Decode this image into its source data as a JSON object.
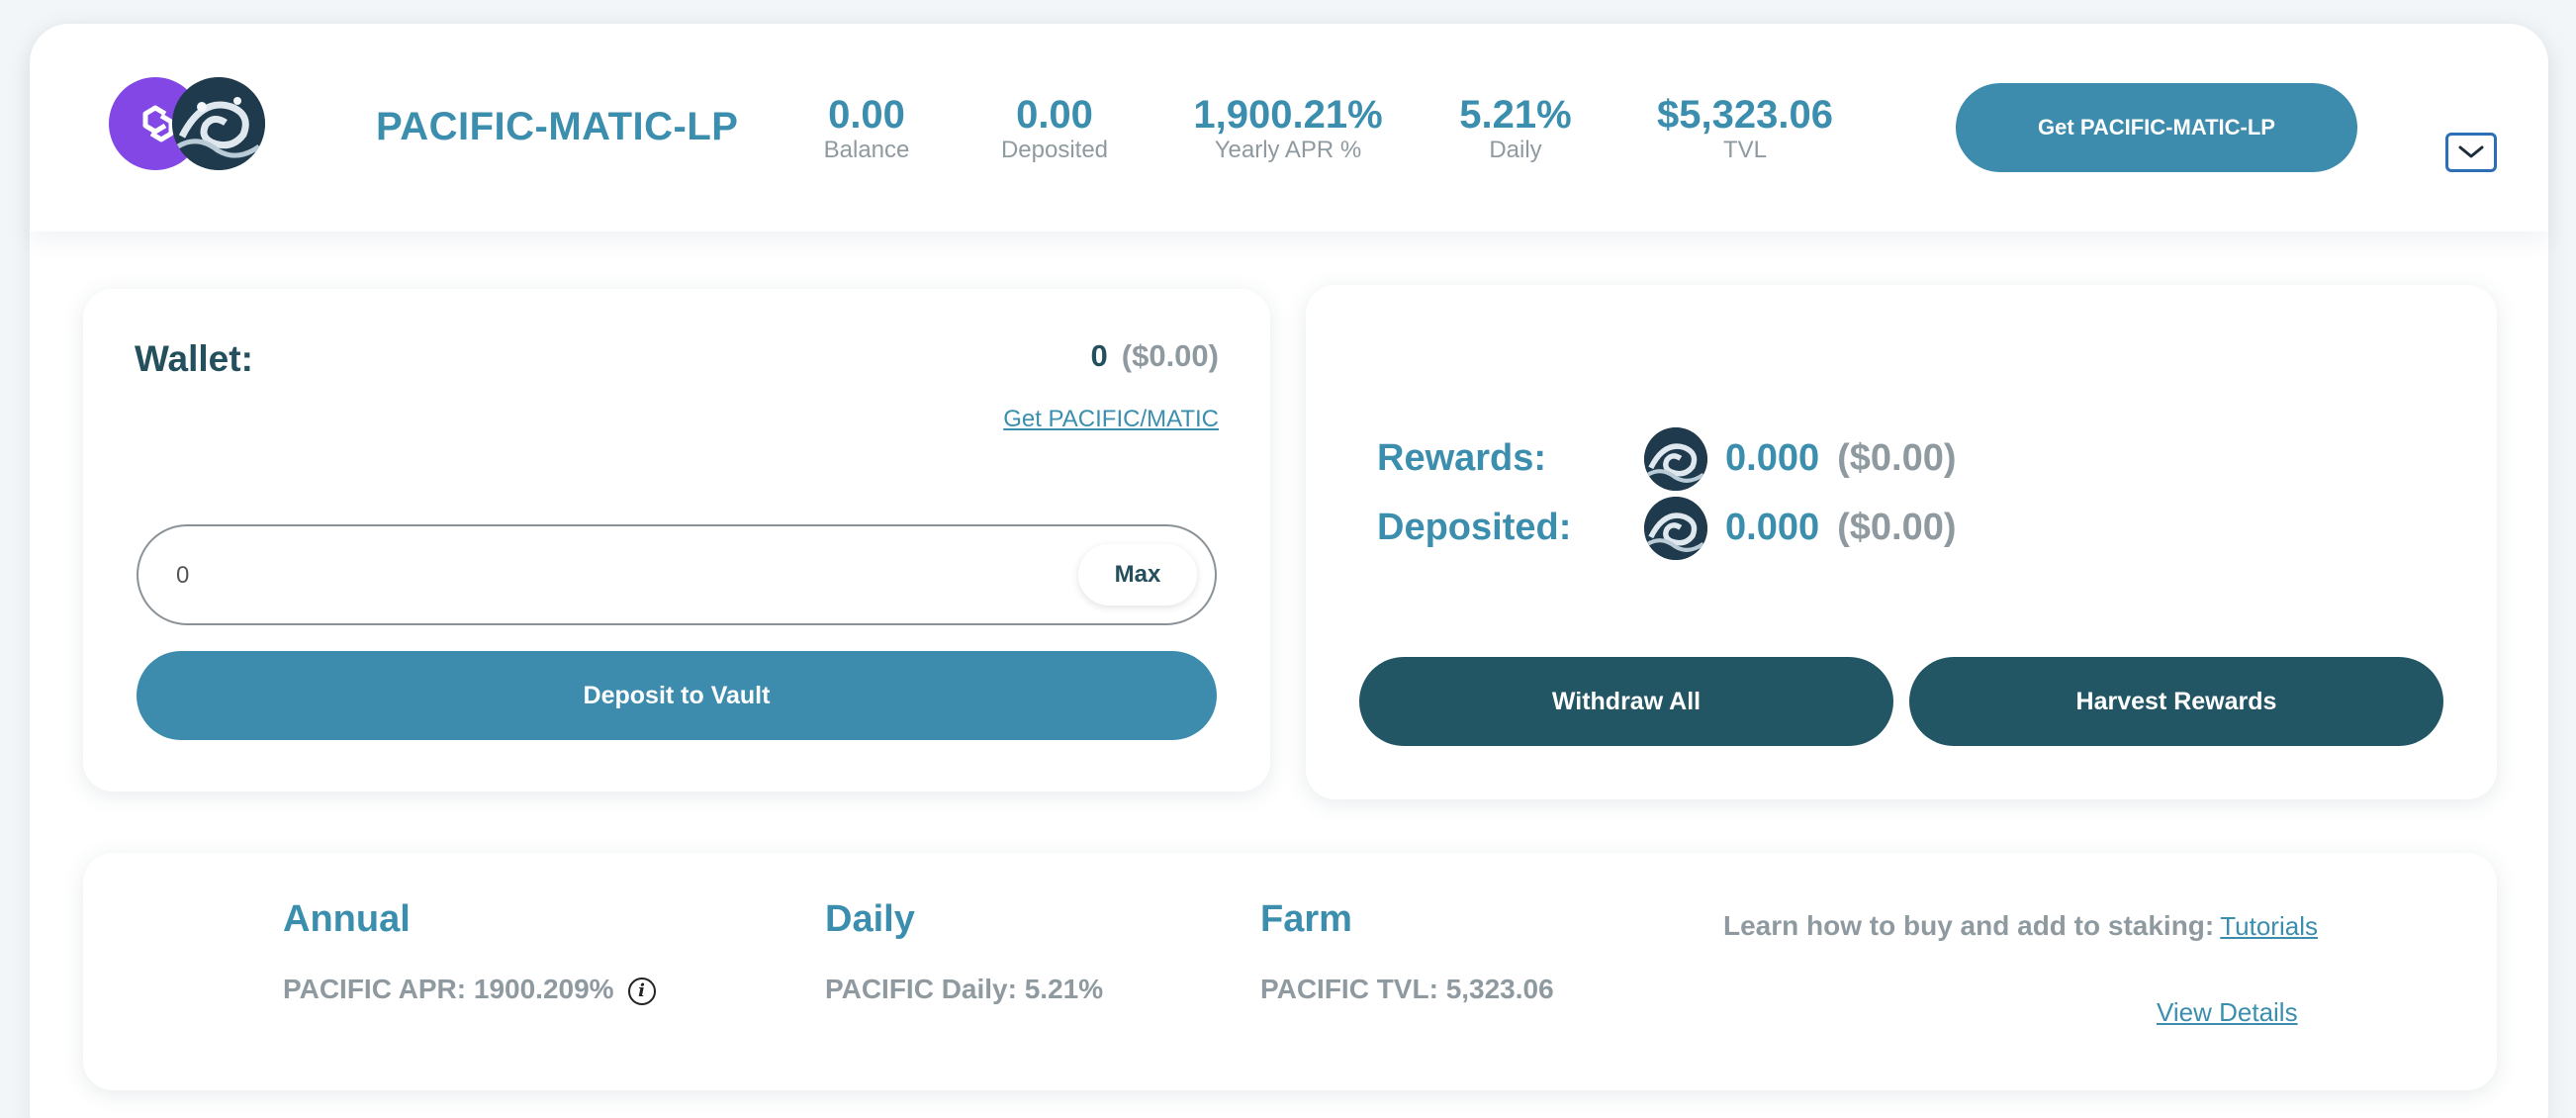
{
  "header": {
    "pair_name": "PACIFIC-MATIC-LP",
    "stats": [
      {
        "value": "0.00",
        "label": "Balance"
      },
      {
        "value": "0.00",
        "label": "Deposited"
      },
      {
        "value": "1,900.21%",
        "label": "Yearly APR %"
      },
      {
        "value": "5.21%",
        "label": "Daily"
      },
      {
        "value": "$5,323.06",
        "label": "TVL"
      }
    ],
    "get_lp_label": "Get PACIFIC-MATIC-LP",
    "toggle_icon": "chevron-down-icon"
  },
  "wallet": {
    "label": "Wallet:",
    "amount": "0",
    "amount_usd": "($0.00)",
    "get_pair_link": "Get PACIFIC/MATIC",
    "input_value": "0",
    "max_label": "Max",
    "deposit_label": "Deposit to Vault"
  },
  "rewards": {
    "rewards_label": "Rewards:",
    "rewards_amount": "0.000",
    "rewards_usd": "($0.00)",
    "deposited_label": "Deposited:",
    "deposited_amount": "0.000",
    "deposited_usd": "($0.00)",
    "withdraw_label": "Withdraw All",
    "harvest_label": "Harvest Rewards"
  },
  "stats": {
    "annual_title": "Annual",
    "annual_text": "PACIFIC APR: 1900.209%",
    "daily_title": "Daily",
    "daily_text": "PACIFIC Daily: 5.21%",
    "farm_title": "Farm",
    "farm_text": "PACIFIC TVL: 5,323.06",
    "learn_text": "Learn how to buy and add to staking:",
    "tutorials_link": "Tutorials",
    "view_details_link": "View Details"
  },
  "colors": {
    "accent": "#3b8ead",
    "button_primary": "#3d8cad",
    "button_dark": "#225664",
    "muted_text": "#8f9aa0",
    "matic_purple": "#8247e5"
  }
}
